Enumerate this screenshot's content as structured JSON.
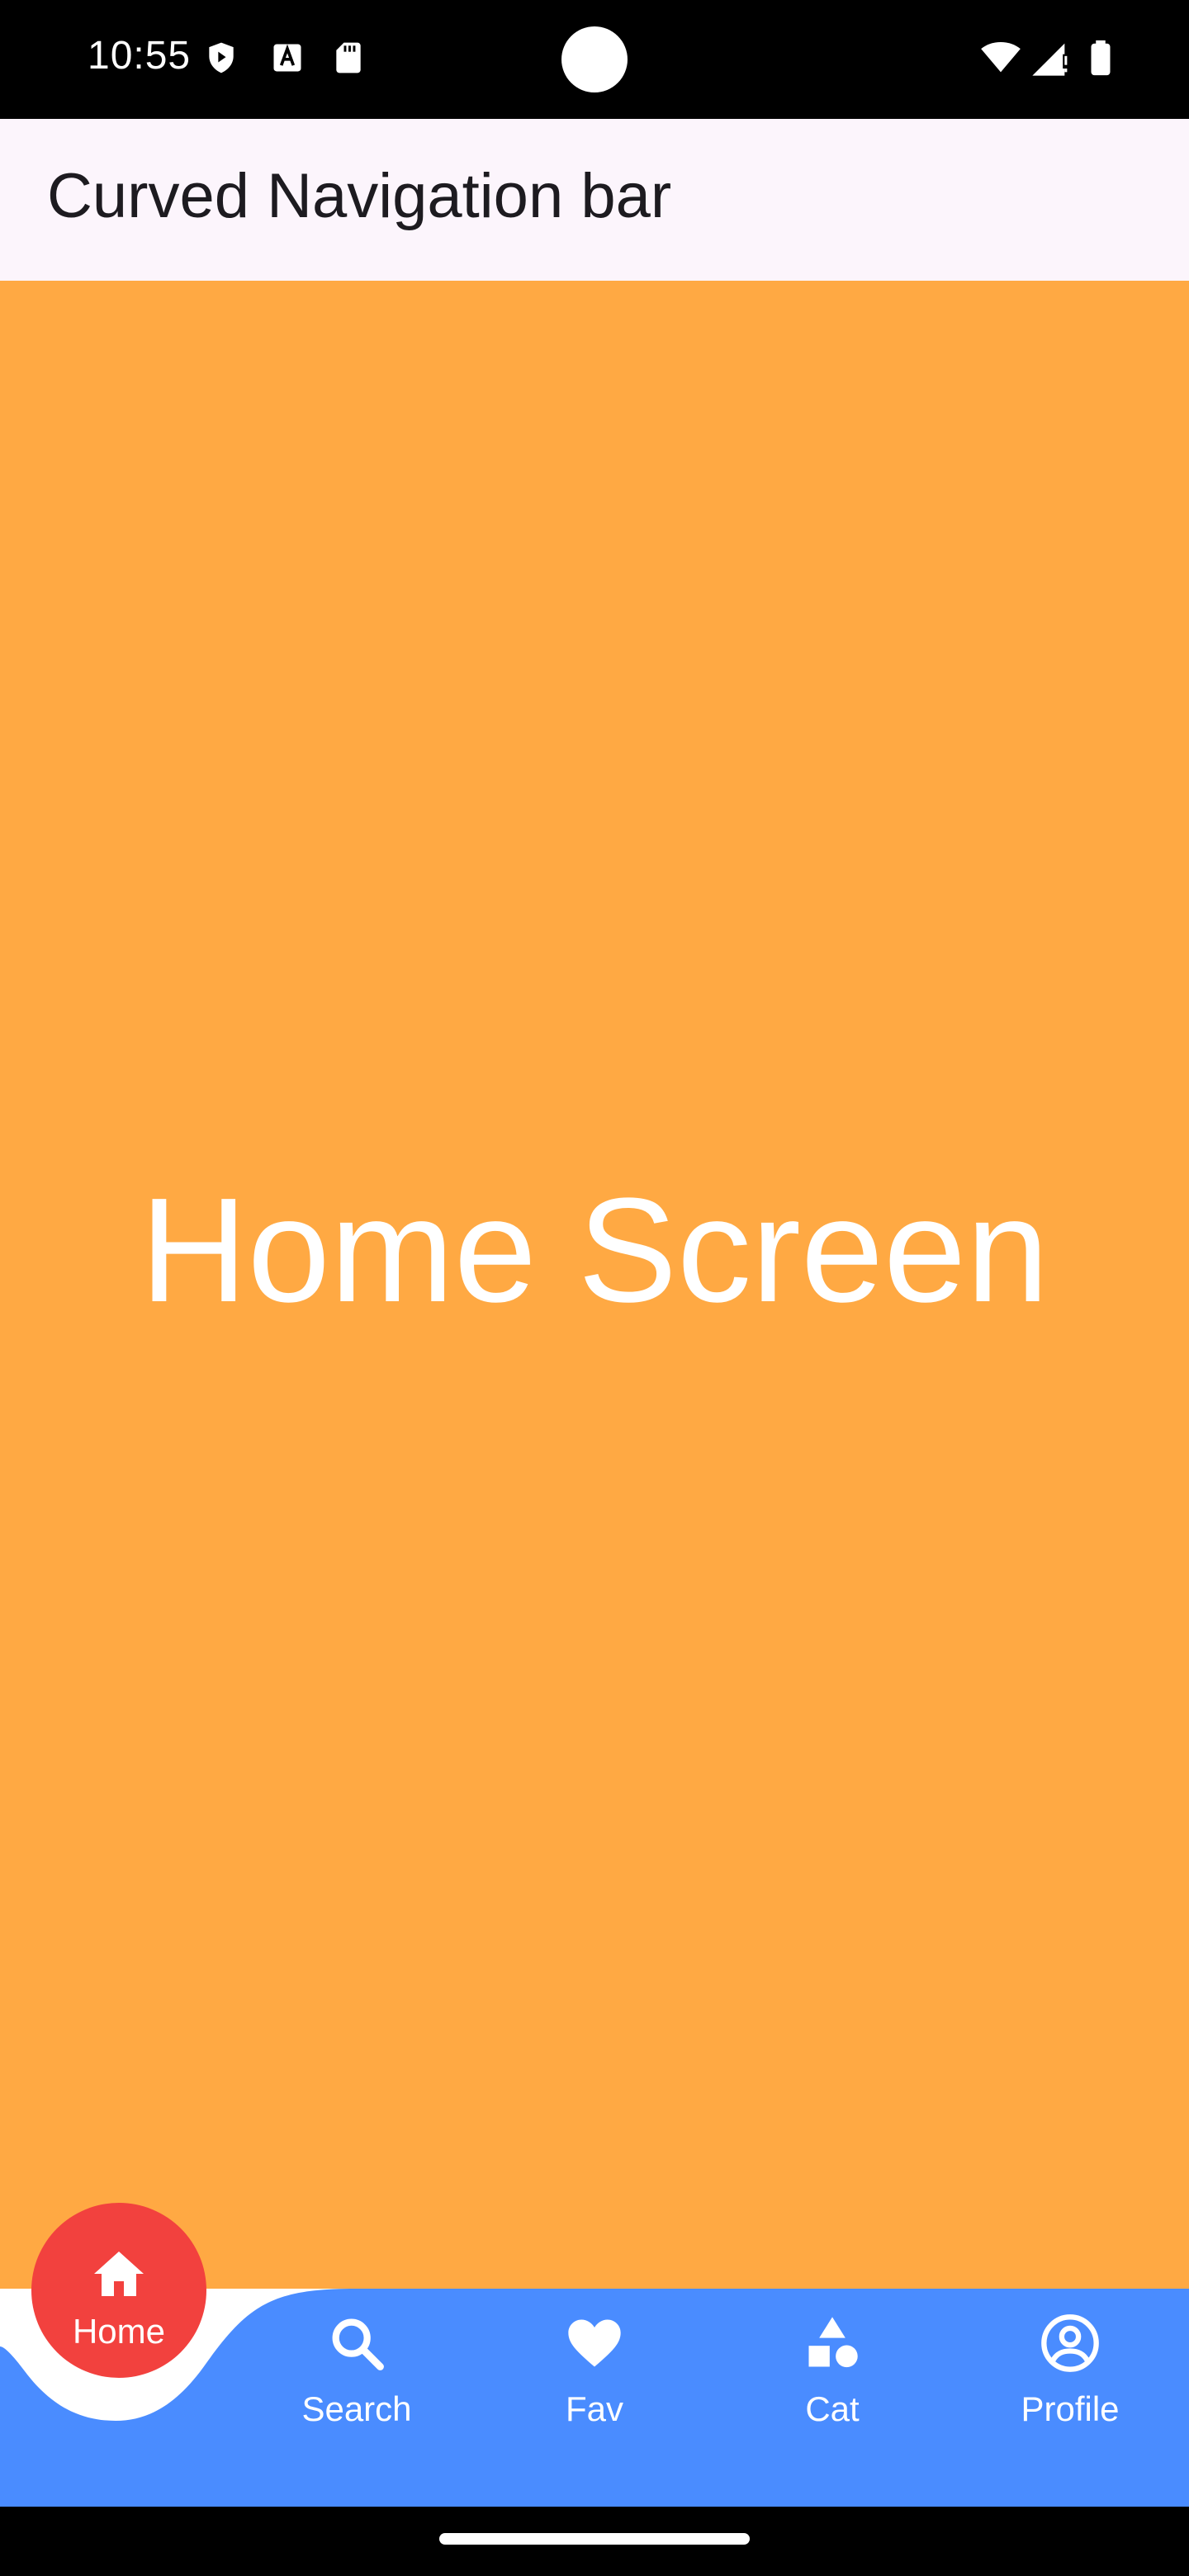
{
  "status_bar": {
    "time": "10:55",
    "left_icons": [
      "shield-play-icon",
      "keyboard-a-icon",
      "sd-card-icon"
    ],
    "right_icons": [
      "wifi-icon",
      "cell-signal-icon",
      "battery-icon"
    ]
  },
  "app_bar": {
    "title": "Curved Navigation bar"
  },
  "main": {
    "screen_title": "Home Screen",
    "background_color": "#ffa943"
  },
  "bottom_nav": {
    "background_color": "#4a8cff",
    "active_color": "#f2413e",
    "active_item": {
      "label": "Home",
      "icon": "home-icon"
    },
    "items": [
      {
        "label": "Search",
        "icon": "search-icon"
      },
      {
        "label": "Fav",
        "icon": "heart-icon"
      },
      {
        "label": "Cat",
        "icon": "category-shapes-icon"
      },
      {
        "label": "Profile",
        "icon": "profile-icon"
      }
    ]
  }
}
